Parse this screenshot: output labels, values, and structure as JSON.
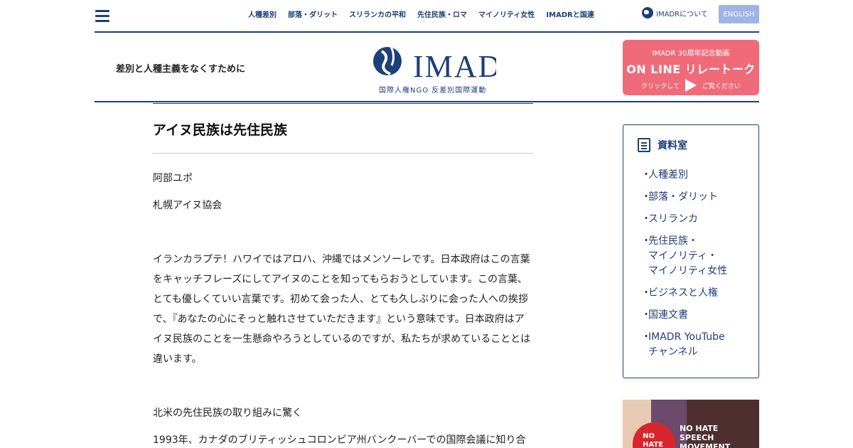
{
  "nav": {
    "items": [
      "人種差別",
      "部落・ダリット",
      "スリランカの平和",
      "先住民族・ロマ",
      "マイノリティ女性",
      "IMADRと国連"
    ],
    "about_label": "IMADRについて",
    "english_label": "ENGLISH"
  },
  "header": {
    "tagline": "差別と人種主義をなくすために",
    "logo_sub": "国際人権NGO 反差別国際運動",
    "promo": {
      "line1": "IMADR 30周年記念動画",
      "line2": "ON LINE リレートーク",
      "click_left": "クリックして",
      "click_right": "ご覧ください"
    }
  },
  "article": {
    "title": "アイヌ民族は先住民族",
    "author": "阿部ユポ",
    "org": "札幌アイヌ協会",
    "body": "イランカラプテ！ハワイではアロハ、沖縄ではメンソーレです。日本政府はこの言葉をキャッチフレーズにしてアイヌのことを知ってもらおうとしています。この言葉、とても優しくていい言葉です。初めて会った人、とても久しぶりに会った人への挨拶で、『あなたの心にそっと触れさせていただきます』という意味です。日本政府はアイヌ民族のことを一生懸命やろうとしているのですが、私たちが求めていることとは違います。",
    "subheading": "北米の先住民族の取り組みに驚く",
    "next": "1993年、カナダのブリティッシュコロンビア州バンクーバーでの国際会議に知り合"
  },
  "sidebar": {
    "title": "資料室",
    "items": [
      "人種差別",
      "部落・ダリット",
      "スリランカ",
      "先住民族・\nマイノリティ・\nマイノリティ女性",
      "ビジネスと人権",
      "国連文書",
      "IMADR YouTube\nチャンネル"
    ]
  },
  "banner": {
    "heart_text": "NO\nHATE",
    "caption": "NO HATE\nSPEECH\nMOVEMENT"
  },
  "colors": {
    "brand": "#1d3f7a",
    "promo": "#f06b7a",
    "english_button": "#9fb4e6"
  }
}
